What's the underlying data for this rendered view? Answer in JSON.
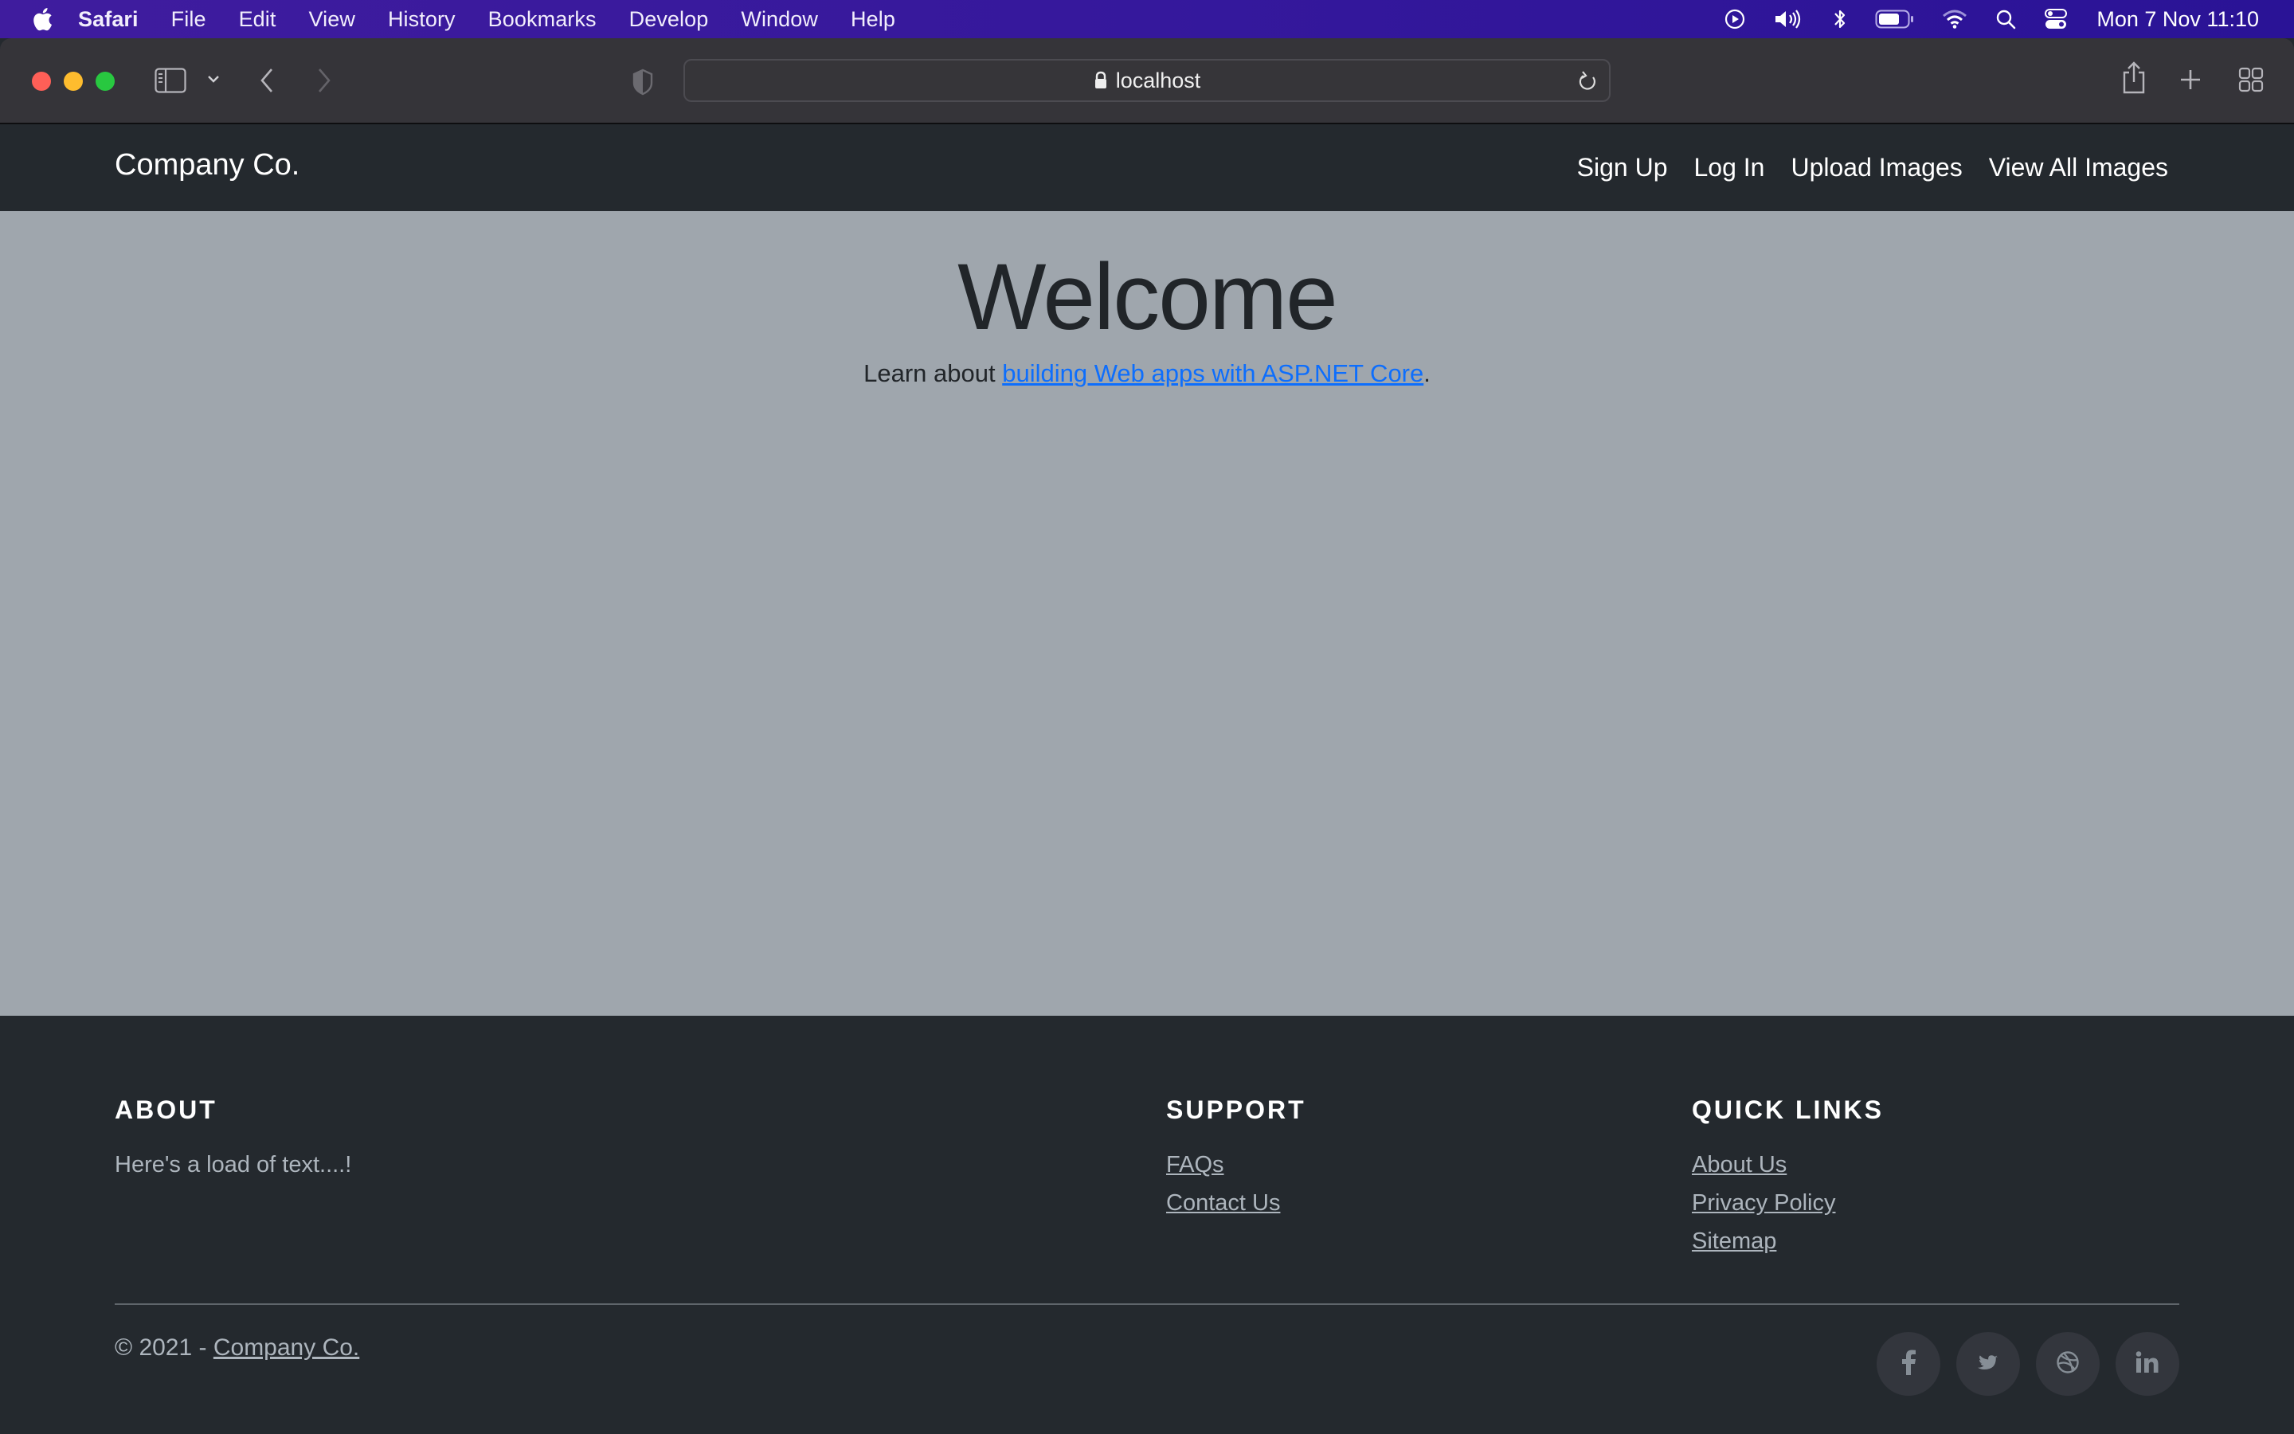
{
  "menubar": {
    "app_name": "Safari",
    "items": [
      "File",
      "Edit",
      "View",
      "History",
      "Bookmarks",
      "Develop",
      "Window",
      "Help"
    ],
    "status_icons": [
      "now-playing-icon",
      "volume-icon",
      "bluetooth-icon",
      "battery-icon",
      "wifi-icon",
      "spotlight-search-icon",
      "control-center-icon"
    ],
    "clock": "Mon 7 Nov  11:10"
  },
  "browser": {
    "url": "localhost"
  },
  "navbar": {
    "brand": "Company Co.",
    "links": [
      "Sign Up",
      "Log In",
      "Upload Images",
      "View All Images"
    ]
  },
  "main": {
    "title": "Welcome",
    "learn_prefix": "Learn about ",
    "learn_link": "building Web apps with ASP.NET Core",
    "learn_suffix": "."
  },
  "footer": {
    "about": {
      "heading": "ABOUT",
      "text": "Here's a load of text....!"
    },
    "support": {
      "heading": "SUPPORT",
      "links": [
        "FAQs",
        "Contact Us"
      ]
    },
    "quick_links": {
      "heading": "QUICK LINKS",
      "links": [
        "About Us",
        "Privacy Policy",
        "Sitemap"
      ]
    },
    "copyright_prefix": "© 2021 - ",
    "copyright_link": "Company Co.",
    "socials": [
      "facebook",
      "twitter",
      "dribbble",
      "linkedin"
    ]
  },
  "colors": {
    "menubar": "#3a1a9c",
    "toolbar": "#353439",
    "navbar": "#24292e",
    "content_bg": "#9fa6ad",
    "link": "#0d6efd",
    "footer_text": "#adb5bd"
  }
}
